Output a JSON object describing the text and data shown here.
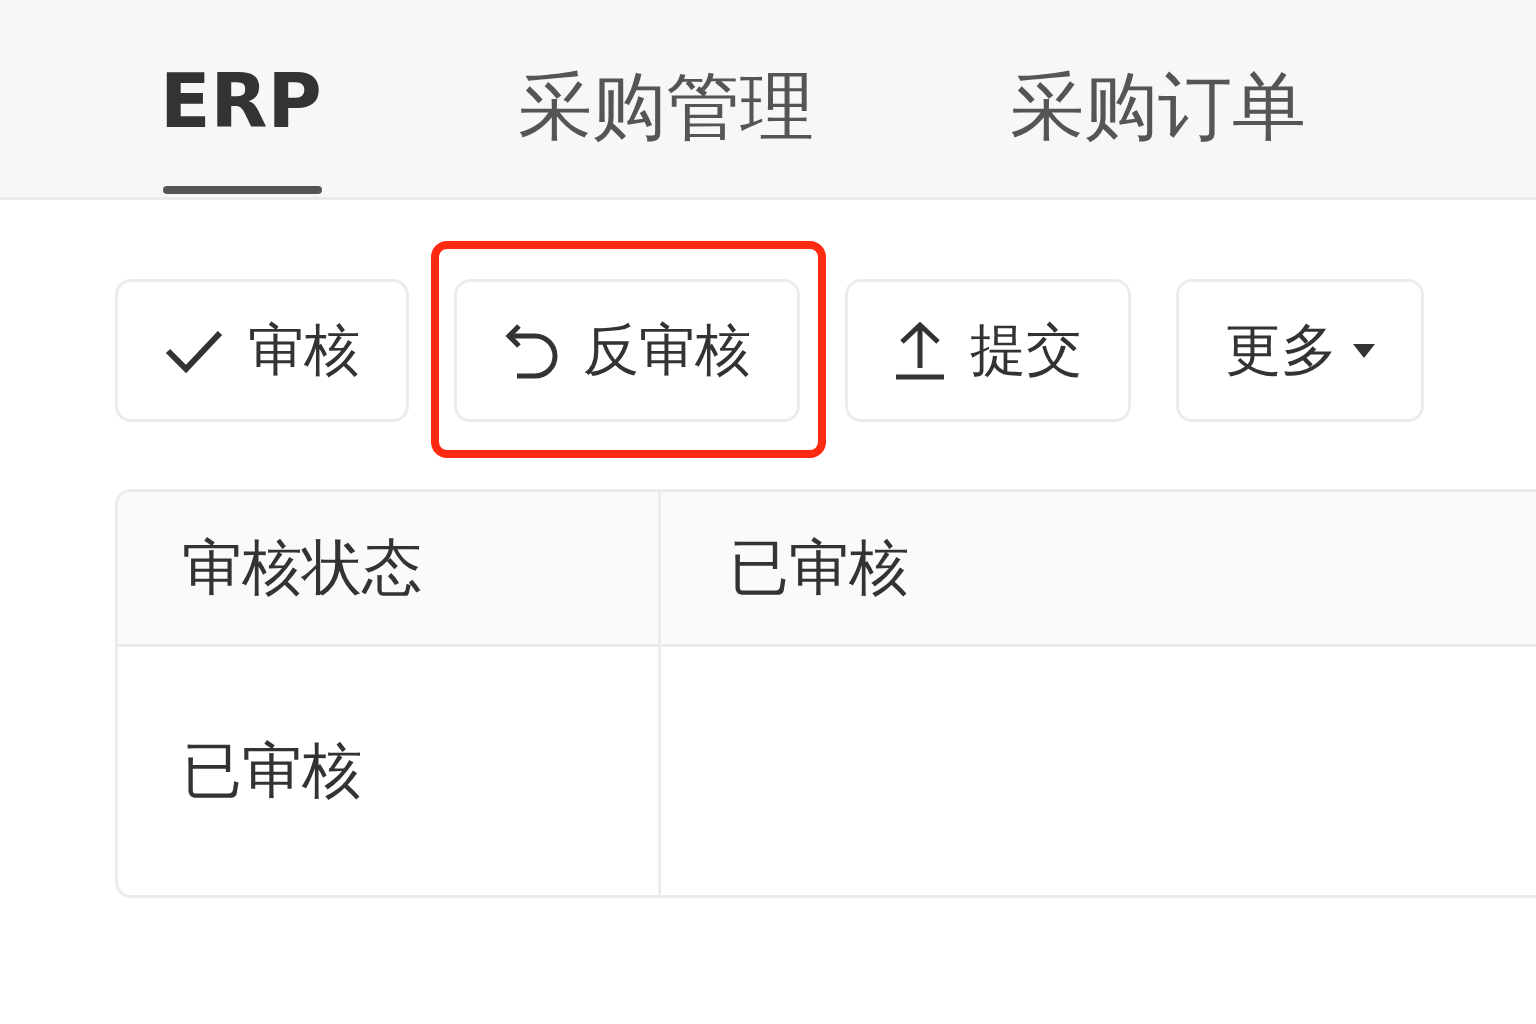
{
  "tabs": [
    {
      "label": "ERP",
      "selected": true
    },
    {
      "label": "采购管理",
      "selected": false
    },
    {
      "label": "采购订单",
      "selected": false
    }
  ],
  "toolbar": [
    {
      "kind": "approve",
      "label": "审核",
      "highlighted": false
    },
    {
      "kind": "unapprove",
      "label": "反审核",
      "highlighted": true
    },
    {
      "kind": "submit",
      "label": "提交",
      "highlighted": false
    },
    {
      "kind": "more",
      "label": "更多",
      "highlighted": false
    }
  ],
  "table": {
    "rows": [
      {
        "cells": [
          "审核状态",
          "已审核"
        ]
      },
      {
        "cells": [
          "已审核"
        ]
      }
    ]
  }
}
